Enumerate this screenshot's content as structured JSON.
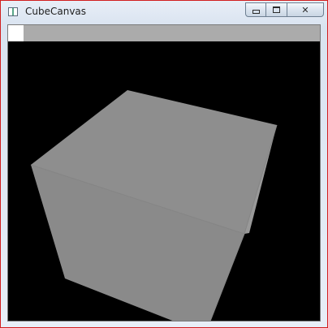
{
  "window": {
    "title": "CubeCanvas",
    "icon": "app-window-icon",
    "controls": {
      "minimize": "minimize-icon",
      "maximize": "maximize-icon",
      "close_glyph": "✕"
    }
  },
  "toolbar_progress": {
    "value_fraction": 0.05,
    "fill_color": "#ffffff",
    "track_color": "#ababab"
  },
  "canvas": {
    "background": "#000000",
    "cube": {
      "top_face_color": "#8e8e8e",
      "left_face_color": "#8a8a8a",
      "right_face_color": "#999999",
      "edge_color": "#858585"
    }
  }
}
